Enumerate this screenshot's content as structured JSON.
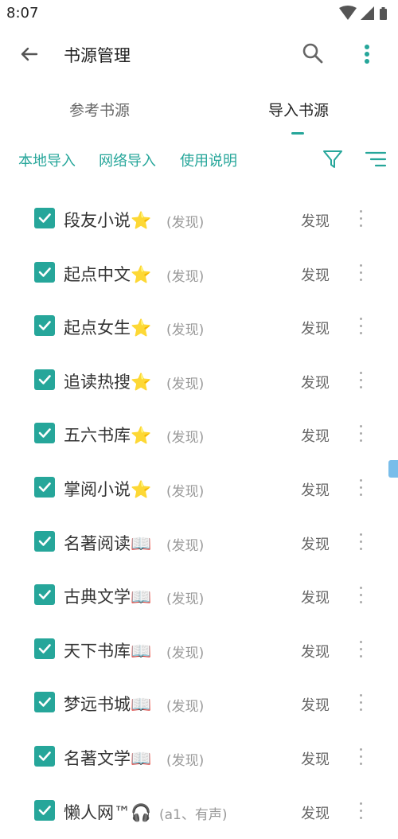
{
  "status": {
    "time": "8:07"
  },
  "appbar": {
    "title": "书源管理"
  },
  "tabs": [
    {
      "label": "参考书源",
      "selected": false
    },
    {
      "label": "导入书源",
      "selected": true
    }
  ],
  "toolbar": {
    "local_import": "本地导入",
    "network_import": "网络导入",
    "instructions": "使用说明"
  },
  "colors": {
    "accent": "#26a69a"
  },
  "rows": [
    {
      "name": "段友小说⭐",
      "group": "(发现)",
      "action": "发现",
      "checked": true
    },
    {
      "name": "起点中文⭐",
      "group": "(发现)",
      "action": "发现",
      "checked": true
    },
    {
      "name": "起点女生⭐",
      "group": "(发现)",
      "action": "发现",
      "checked": true
    },
    {
      "name": "追读热搜⭐",
      "group": "(发现)",
      "action": "发现",
      "checked": true
    },
    {
      "name": "五六书库⭐",
      "group": "(发现)",
      "action": "发现",
      "checked": true
    },
    {
      "name": "掌阅小说⭐",
      "group": "(发现)",
      "action": "发现",
      "checked": true
    },
    {
      "name": "名著阅读📖",
      "group": "(发现)",
      "action": "发现",
      "checked": true
    },
    {
      "name": "古典文学📖",
      "group": "(发现)",
      "action": "发现",
      "checked": true
    },
    {
      "name": "天下书库📖",
      "group": "(发现)",
      "action": "发现",
      "checked": true
    },
    {
      "name": "梦远书城📖",
      "group": "(发现)",
      "action": "发现",
      "checked": true
    },
    {
      "name": "名著文学📖",
      "group": "(发现)",
      "action": "发现",
      "checked": true
    },
    {
      "name": "懒人网™🎧",
      "group": "(a1、有声)",
      "action": "发现",
      "checked": true
    }
  ]
}
